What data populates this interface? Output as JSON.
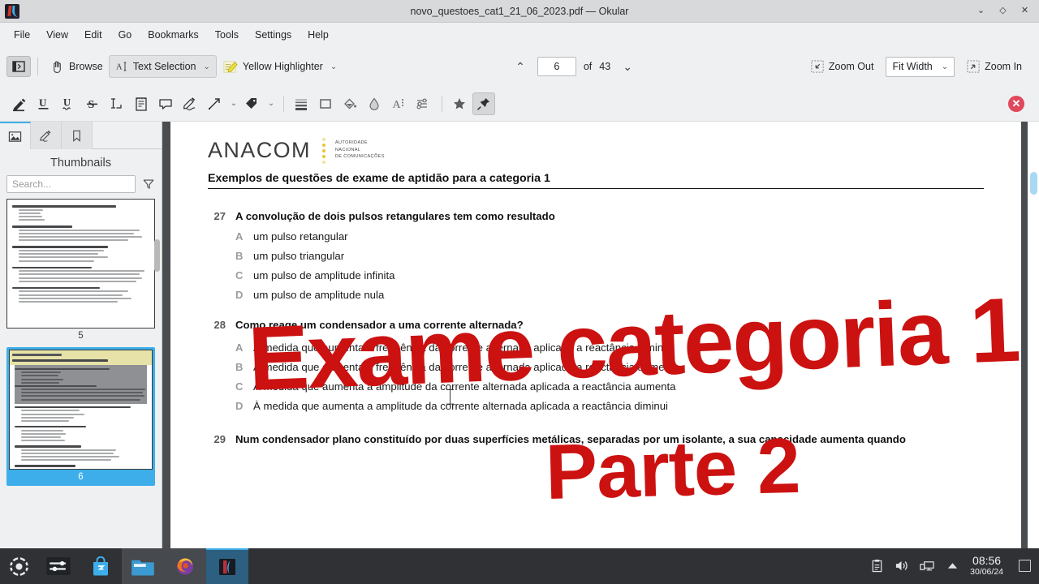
{
  "window": {
    "title": "novo_questoes_cat1_21_06_2023.pdf — Okular",
    "app_icon": "okular-icon",
    "buttons": {
      "minimize": "⌄",
      "maximize": "◇",
      "close": "✕"
    }
  },
  "menubar": {
    "items": [
      {
        "label": "File"
      },
      {
        "label": "View"
      },
      {
        "label": "Edit"
      },
      {
        "label": "Go"
      },
      {
        "label": "Bookmarks"
      },
      {
        "label": "Tools"
      },
      {
        "label": "Settings"
      },
      {
        "label": "Help"
      }
    ]
  },
  "toolbar": {
    "sidebar_toggle": "show-sidebar-icon",
    "browse_label": "Browse",
    "text_selection_label": "Text Selection",
    "highlighter_label": "Yellow Highlighter",
    "caret": "⌄",
    "prev_page": "⌃",
    "next_page": "⌄",
    "current_page": "6",
    "of_label": "of",
    "total_pages": "43",
    "zoom_out_label": "Zoom Out",
    "zoom_mode": "Fit Width",
    "zoom_in_label": "Zoom In"
  },
  "annotation_toolbar": {
    "tools": [
      {
        "name": "highlighter-pen-icon"
      },
      {
        "name": "underline-icon"
      },
      {
        "name": "squiggly-underline-icon"
      },
      {
        "name": "strikeout-icon"
      },
      {
        "name": "typewriter-icon"
      },
      {
        "name": "inline-note-icon"
      },
      {
        "name": "popup-note-icon"
      },
      {
        "name": "freehand-line-icon"
      },
      {
        "name": "arrow-icon"
      },
      {
        "name": "stamp-icon"
      }
    ],
    "style_tools": [
      {
        "name": "line-width-icon"
      },
      {
        "name": "shape-rectangle-icon"
      },
      {
        "name": "fill-color-icon"
      },
      {
        "name": "opacity-icon"
      },
      {
        "name": "font-icon"
      },
      {
        "name": "advanced-settings-icon"
      }
    ],
    "favorite_icon": "star-icon",
    "pin_icon": "pin-icon",
    "close_icon": "close-annotation-toolbar-icon"
  },
  "sidebar": {
    "tabs": [
      {
        "name": "thumbnails-tab",
        "icon": "image-icon",
        "active": true
      },
      {
        "name": "annotations-tab",
        "icon": "pen-icon",
        "active": false
      },
      {
        "name": "bookmarks-tab",
        "icon": "bookmark-icon",
        "active": false
      }
    ],
    "title": "Thumbnails",
    "search_placeholder": "Search...",
    "filter_icon": "filter-icon",
    "thumbnails": [
      {
        "page": "5",
        "selected": false
      },
      {
        "page": "6",
        "selected": true
      }
    ]
  },
  "document": {
    "logo": {
      "word": "ANACOM",
      "subtitle_lines": [
        "AUTORIDADE",
        "NACIONAL",
        "DE COMUNICAÇÕES"
      ]
    },
    "heading": "Exemplos de questões de exame de aptidão para a categoria  1",
    "questions": [
      {
        "number": "27",
        "text": "A convolução de dois pulsos retangulares tem como resultado",
        "answers": [
          {
            "letter": "A",
            "text": "um pulso retangular"
          },
          {
            "letter": "B",
            "text": "um pulso triangular"
          },
          {
            "letter": "C",
            "text": "um pulso de amplitude infinita"
          },
          {
            "letter": "D",
            "text": "um pulso de amplitude nula"
          }
        ]
      },
      {
        "number": "28",
        "text": "Como reage um condensador a uma corrente alternada?",
        "answers": [
          {
            "letter": "A",
            "text": "À medida que aumenta a frequência da corrente alternada aplicada a reactância diminui"
          },
          {
            "letter": "B",
            "text": "À medida que aumenta a frequência da corrente alternada aplicada a reactância aumenta"
          },
          {
            "letter": "C",
            "text": "À medida que aumenta a amplitude da corrente alternada aplicada a reactância aumenta"
          },
          {
            "letter": "D",
            "text": "À medida que aumenta a amplitude da corrente alternada aplicada a reactância diminui"
          }
        ]
      },
      {
        "number": "29",
        "text": "Num condensador plano constituído por duas superfícies metálicas, separadas por um isolante, a sua capacidade aumenta quando",
        "answers": []
      }
    ],
    "watermark": {
      "line1": "Exame categoria 1",
      "line2": "Parte 2",
      "color": "#cc1111"
    }
  },
  "taskbar": {
    "launcher": "kde-menu-icon",
    "items": [
      {
        "name": "system-settings-icon",
        "state": "normal"
      },
      {
        "name": "discover-store-icon",
        "state": "normal"
      },
      {
        "name": "file-manager-icon",
        "state": "window"
      },
      {
        "name": "firefox-icon",
        "state": "window"
      },
      {
        "name": "okular-icon",
        "state": "active"
      }
    ],
    "tray": [
      {
        "name": "clipboard-icon"
      },
      {
        "name": "volume-icon"
      },
      {
        "name": "network-icon"
      },
      {
        "name": "show-hidden-icon"
      }
    ],
    "clock_time": "08:56",
    "clock_date": "30/06/24",
    "show_desktop": "show-desktop-icon"
  },
  "colors": {
    "accent": "#3daee9",
    "watermark_red": "#cc1111",
    "highlight_yellow": "#f5e642"
  }
}
